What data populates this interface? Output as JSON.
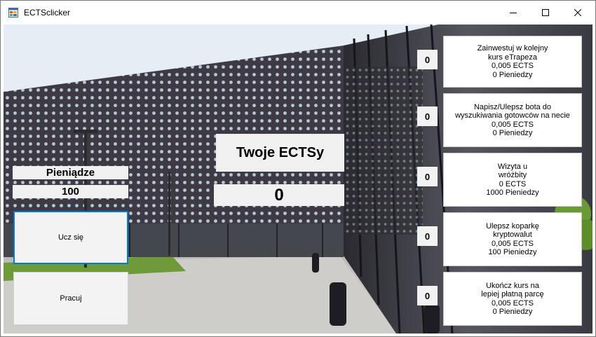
{
  "window": {
    "title": "ECTSclicker",
    "icons": {
      "app": "app-window-icon",
      "minimize": "minimize-icon",
      "maximize": "maximize-icon",
      "close": "close-icon"
    }
  },
  "money": {
    "label": "Pieniądze",
    "value": "100"
  },
  "ects": {
    "label": "Twoje ECTSy",
    "value": "0"
  },
  "actions": {
    "study_label": "Ucz się",
    "work_label": "Pracuj"
  },
  "upgrades": [
    {
      "count": "0",
      "lines": [
        "Zainwestuj w kolejny",
        "kurs eTrapeza",
        "0,005 ECTS",
        "0 Pieniedzy"
      ]
    },
    {
      "count": "0",
      "lines": [
        "Napisz/Ulepsz bota do",
        "wyszukiwania gotowców na necie",
        "0,005 ECTS",
        "0 Pieniedzy"
      ]
    },
    {
      "count": "0",
      "lines": [
        "Wizyta u",
        "wróżbity",
        "0 ECTS",
        "1000 Pieniedzy"
      ]
    },
    {
      "count": "0",
      "lines": [
        "Ulepsz koparkę",
        "kryptowalut",
        "0,005 ECTS",
        "100 Pieniedzy"
      ]
    },
    {
      "count": "0",
      "lines": [
        "Ukończ kurs na",
        "lepiej płatną parcę",
        "0,005 ECTS",
        "0 Pieniedzy"
      ]
    }
  ],
  "colors": {
    "accent_border": "#0078d7",
    "button_face": "#f3f3f3"
  }
}
